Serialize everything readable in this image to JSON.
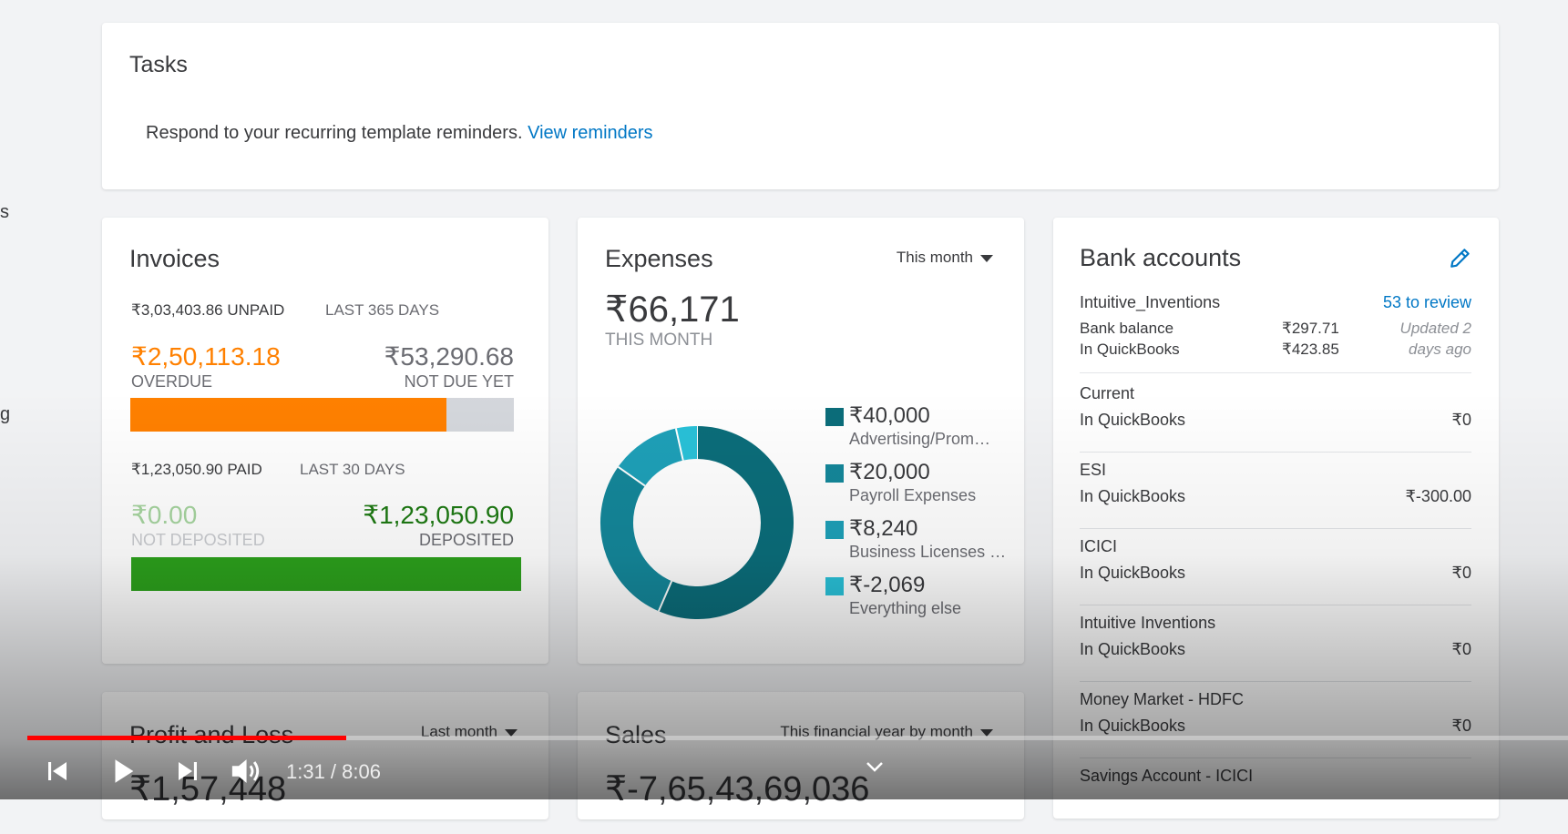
{
  "sidebar_fragments": [
    "s",
    "g"
  ],
  "tasks": {
    "title": "Tasks",
    "message": "Respond to your recurring template reminders.",
    "link": "View reminders"
  },
  "invoices": {
    "title": "Invoices",
    "unpaid_label": "₹3,03,403.86 UNPAID",
    "unpaid_period": "LAST 365 DAYS",
    "overdue_amount": "₹2,50,113.18",
    "overdue_label": "OVERDUE",
    "notdue_amount": "₹53,290.68",
    "notdue_label": "NOT DUE YET",
    "unpaid_bar_overdue_fraction": 0.824,
    "paid_label": "₹1,23,050.90 PAID",
    "paid_period": "LAST 30 DAYS",
    "notdeposited_amount": "₹0.00",
    "notdeposited_label": "NOT DEPOSITED",
    "deposited_amount": "₹1,23,050.90",
    "deposited_label": "DEPOSITED",
    "colors": {
      "overdue": "#ff8000",
      "notdue": "#d4d7dc",
      "deposited": "#2ca01c",
      "deposited_text": "#1e7a14",
      "notdeposited_text": "#a6d49f"
    }
  },
  "expenses": {
    "title": "Expenses",
    "period": "This month",
    "total": "₹66,171",
    "total_label": "THIS MONTH",
    "legend": [
      {
        "value": "₹40,000",
        "label": "Advertising/Prom…",
        "color": "#0b6d7a"
      },
      {
        "value": "₹20,000",
        "label": "Payroll Expenses",
        "color": "#14879a"
      },
      {
        "value": "₹8,240",
        "label": "Business Licenses …",
        "color": "#1ea0b8"
      },
      {
        "value": "₹-2,069",
        "label": "Everything else",
        "color": "#29c1d8"
      }
    ]
  },
  "chart_data": {
    "type": "pie",
    "categories": [
      "Advertising/Prom…",
      "Payroll Expenses",
      "Business Licenses …",
      "Everything else"
    ],
    "values": [
      40000,
      20000,
      8240,
      -2069
    ],
    "display_fractions": [
      0.565,
      0.283,
      0.117,
      0.035
    ],
    "title": "Expenses",
    "donut": true
  },
  "bank": {
    "title": "Bank accounts",
    "primary": {
      "name": "Intuitive_Inventions",
      "review_link": "53 to review",
      "bank_balance_label": "Bank balance",
      "bank_balance": "₹297.71",
      "qb_label": "In QuickBooks",
      "qb_balance": "₹423.85",
      "updated_line1": "Updated 2",
      "updated_line2": "days ago"
    },
    "accounts": [
      {
        "name": "Current",
        "sub": "In QuickBooks",
        "value": "₹0"
      },
      {
        "name": "ESI",
        "sub": "In QuickBooks",
        "value": "₹-300.00"
      },
      {
        "name": "ICICI",
        "sub": "In QuickBooks",
        "value": "₹0"
      },
      {
        "name": "Intuitive Inventions",
        "sub": "In QuickBooks",
        "value": "₹0"
      },
      {
        "name": "Money Market - HDFC",
        "sub": "In QuickBooks",
        "value": "₹0"
      },
      {
        "name": "Savings Account - ICICI",
        "sub": "",
        "value": ""
      }
    ]
  },
  "profit_loss": {
    "title": "Profit and Loss",
    "period": "Last month",
    "amount": "₹1,57,448"
  },
  "sales": {
    "title": "Sales",
    "period": "This financial year by month",
    "amount": "₹-7,65,43,69,036"
  },
  "player": {
    "time": "1:31 / 8:06",
    "progress_fraction": 0.207
  }
}
